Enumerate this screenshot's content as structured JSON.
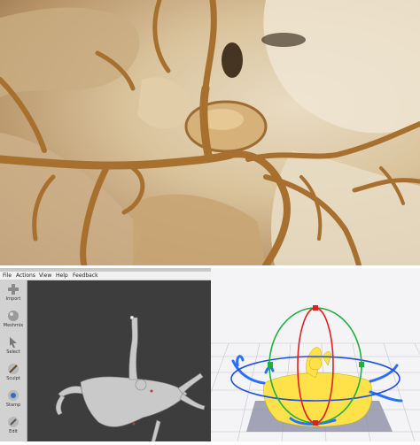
{
  "meshmixer": {
    "menu": [
      {
        "label": "File"
      },
      {
        "label": "Actions"
      },
      {
        "label": "View"
      },
      {
        "label": "Help"
      },
      {
        "label": "Feedback"
      }
    ],
    "tools": [
      {
        "label": "Import",
        "icon": "plus-icon"
      },
      {
        "label": "Meshmix",
        "icon": "sphere-icon"
      },
      {
        "label": "Select",
        "icon": "cursor-arrow-icon"
      },
      {
        "label": "Sculpt",
        "icon": "brush-icon"
      },
      {
        "label": "Stamp",
        "icon": "stamp-icon"
      },
      {
        "label": "Edit",
        "icon": "pencil-icon"
      }
    ]
  },
  "colors": {
    "bone": "#e6d6b6",
    "vessel": "#b07a3a",
    "mm_background": "#3d3d3d",
    "cura_model": "#ffe24a",
    "cura_outline": "#2a6fff",
    "cura_shadow": "#8e8ea8",
    "gizmo_red": "#e02020",
    "gizmo_green": "#20b040",
    "gizmo_blue": "#2050e0"
  }
}
